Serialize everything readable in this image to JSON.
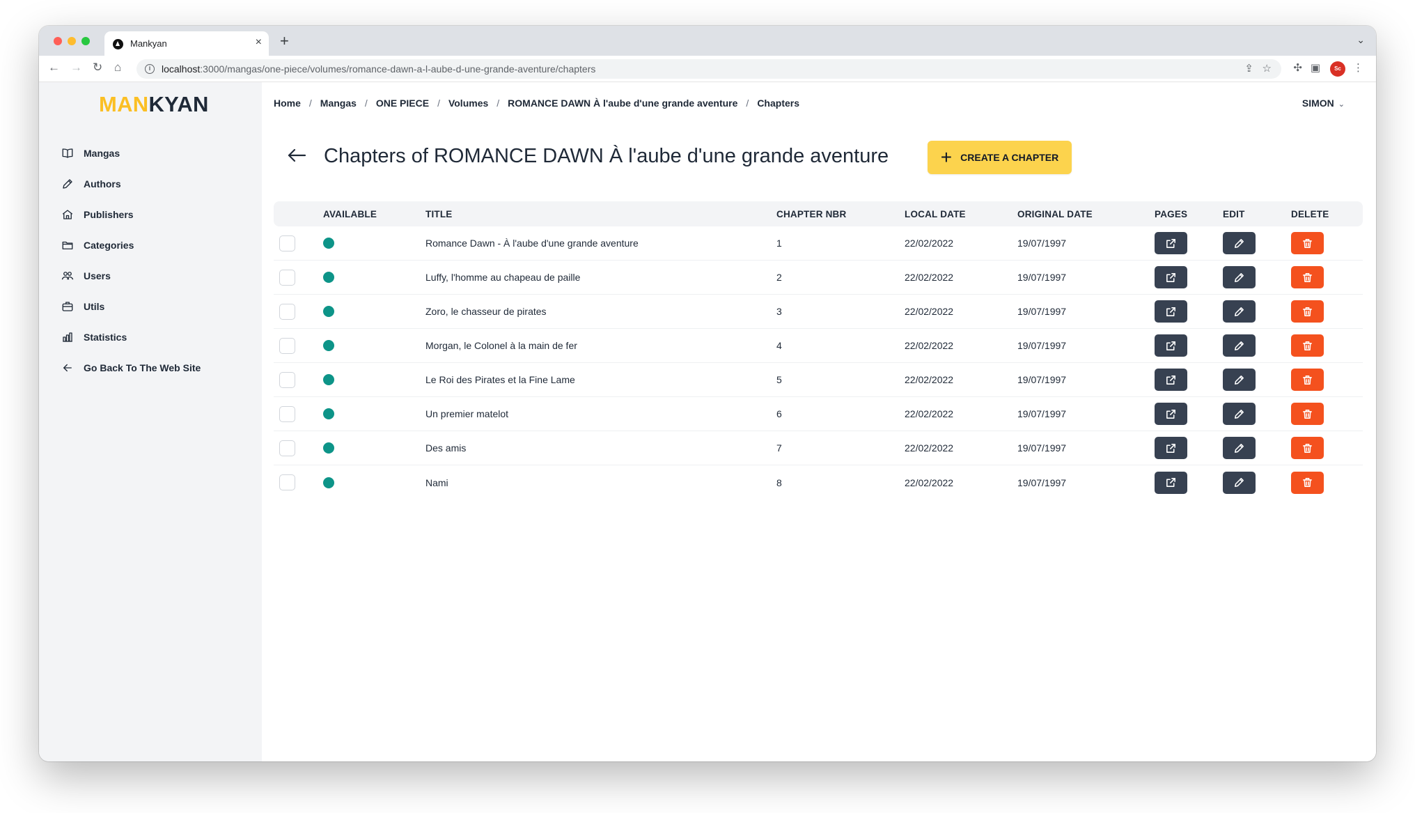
{
  "browser": {
    "tab_title": "Mankyan",
    "tab_close": "×",
    "new_tab": "+",
    "url_host": "localhost",
    "url_path": ":3000/mangas/one-piece/volumes/romance-dawn-a-l-aube-d-une-grande-aventure/chapters",
    "profile_initials": "Sc"
  },
  "logo": {
    "part1": "MAN",
    "part2": "KYAN"
  },
  "sidebar": {
    "items": [
      {
        "label": "Mangas",
        "icon": "book-open-icon"
      },
      {
        "label": "Authors",
        "icon": "pencil-icon"
      },
      {
        "label": "Publishers",
        "icon": "home-icon"
      },
      {
        "label": "Categories",
        "icon": "folder-icon"
      },
      {
        "label": "Users",
        "icon": "users-icon"
      },
      {
        "label": "Utils",
        "icon": "briefcase-icon"
      },
      {
        "label": "Statistics",
        "icon": "bar-chart-icon"
      },
      {
        "label": "Go Back To The Web Site",
        "icon": "arrow-left-icon"
      }
    ]
  },
  "breadcrumb": [
    "Home",
    "Mangas",
    "ONE PIECE",
    "Volumes",
    "ROMANCE DAWN À l'aube d'une grande aventure",
    "Chapters"
  ],
  "breadcrumb_separator": "/",
  "user": {
    "name": "SIMON",
    "chevron": "⌄"
  },
  "page": {
    "title": "Chapters of ROMANCE DAWN À l'aube d'une grande aventure",
    "create_label": "CREATE A CHAPTER",
    "create_plus": "+"
  },
  "table": {
    "columns": [
      "AVAILABLE",
      "TITLE",
      "CHAPTER NBR",
      "LOCAL DATE",
      "ORIGINAL DATE",
      "PAGES",
      "EDIT",
      "DELETE"
    ],
    "rows": [
      {
        "available": true,
        "title": "Romance Dawn - À l'aube d'une grande aventure",
        "number": "1",
        "local_date": "22/02/2022",
        "original_date": "19/07/1997"
      },
      {
        "available": true,
        "title": "Luffy, l'homme au chapeau de paille",
        "number": "2",
        "local_date": "22/02/2022",
        "original_date": "19/07/1997"
      },
      {
        "available": true,
        "title": "Zoro, le chasseur de pirates",
        "number": "3",
        "local_date": "22/02/2022",
        "original_date": "19/07/1997"
      },
      {
        "available": true,
        "title": "Morgan, le Colonel à la main de fer",
        "number": "4",
        "local_date": "22/02/2022",
        "original_date": "19/07/1997"
      },
      {
        "available": true,
        "title": "Le Roi des Pirates et la Fine Lame",
        "number": "5",
        "local_date": "22/02/2022",
        "original_date": "19/07/1997"
      },
      {
        "available": true,
        "title": "Un premier matelot",
        "number": "6",
        "local_date": "22/02/2022",
        "original_date": "19/07/1997"
      },
      {
        "available": true,
        "title": "Des amis",
        "number": "7",
        "local_date": "22/02/2022",
        "original_date": "19/07/1997"
      },
      {
        "available": true,
        "title": "Nami",
        "number": "8",
        "local_date": "22/02/2022",
        "original_date": "19/07/1997"
      }
    ]
  },
  "colors": {
    "accent": "#fcd34d",
    "logo_accent": "#fbbf24",
    "available_dot": "#0d9488",
    "dark_button": "#374151",
    "delete_button": "#f4511e",
    "sidebar_bg": "#f3f4f6"
  }
}
